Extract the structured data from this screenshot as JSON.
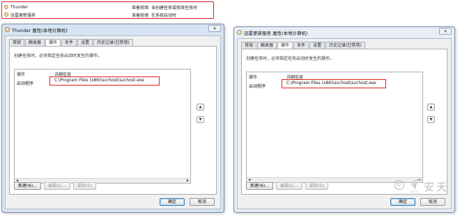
{
  "task_list": {
    "rows": [
      {
        "name": "Thunder",
        "status": "准备就绪",
        "trigger": "当创建任务或修改任务时"
      },
      {
        "name": "迅雷更新服务",
        "status": "准备就绪",
        "trigger": "在系统启动时"
      }
    ]
  },
  "dialogs": {
    "left": {
      "title": "Thunder 属性(本地计算机)",
      "close_label": "×",
      "tabs": [
        "常规",
        "触发器",
        "操作",
        "条件",
        "设置",
        "历史记录(已禁用)"
      ],
      "active_tab": "操作",
      "description": "创建任务时，必须指定任务启动时发生的操作。",
      "table": {
        "headers": [
          "操作",
          "详细信息"
        ],
        "rows": [
          {
            "action": "启动程序",
            "detail": "C:\\Program Files (x86)\\svchost\\svchost.exe"
          }
        ]
      },
      "move_up_label": "▲",
      "move_down_label": "▼",
      "new_label": "新建(N)...",
      "edit_label": "编辑(E)...",
      "delete_label": "删除(D)",
      "ok_label": "确定",
      "cancel_label": "取消"
    },
    "right": {
      "title": "迅雷更新服务 属性(本地计算机)",
      "close_label": "×",
      "tabs": [
        "常规",
        "触发器",
        "操作",
        "条件",
        "设置",
        "历史记录(已禁用)"
      ],
      "active_tab": "操作",
      "description": "创建任务时，必须指定任务启动时发生的操作。",
      "table": {
        "headers": [
          "操作",
          "详细信息"
        ],
        "rows": [
          {
            "action": "启动程序",
            "detail": "C:\\Program Files (x86)\\svchost\\svchost.exe"
          }
        ]
      },
      "move_up_label": "▲",
      "move_down_label": "▼",
      "new_label": "新建(N)...",
      "edit_label": "编辑(E)...",
      "delete_label": "删除(D)",
      "ok_label": "确定",
      "cancel_label": "取消"
    }
  },
  "watermark": {
    "copyright_symbol": "©",
    "brand": "安天",
    "sub": "ANTIY"
  },
  "colors": {
    "highlight": "#e01a1a",
    "dialog_frame": "#d6e3f2"
  }
}
